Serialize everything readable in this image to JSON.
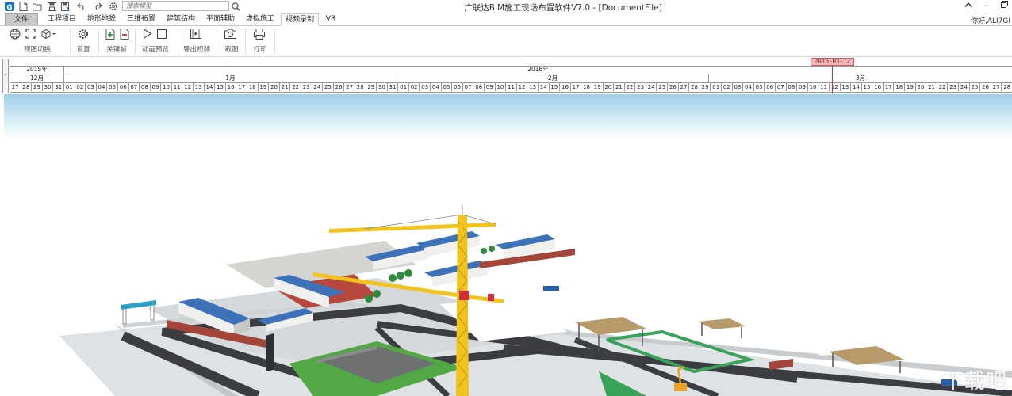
{
  "app": {
    "title": "广联达BIM施工现场布置软件V7.0 - [DocumentFile]",
    "greeting": "你好,ALI7GI",
    "search_placeholder": "搜索模型"
  },
  "tabs": [
    {
      "label": "文件"
    },
    {
      "label": "工程项目"
    },
    {
      "label": "地形地貌"
    },
    {
      "label": "三维布置"
    },
    {
      "label": "建筑结构"
    },
    {
      "label": "平面辅助"
    },
    {
      "label": "虚拟施工"
    },
    {
      "label": "视频录制"
    },
    {
      "label": "VR"
    }
  ],
  "active_tab": "视频录制",
  "ribbon": {
    "view_switch": "视图切换",
    "settings": "设置",
    "keyframe": "关键帧",
    "animation_preview": "动画预览",
    "export_video": "导出视频",
    "screenshot": "截图",
    "print": "打印"
  },
  "timeline": {
    "marker_date": "2016-03-12",
    "years": [
      "2015年",
      "2016年"
    ],
    "months": [
      "12月",
      "1月",
      "2月",
      "3月"
    ],
    "days": [
      "27",
      "28",
      "29",
      "30",
      "31",
      "01",
      "02",
      "03",
      "04",
      "05",
      "06",
      "07",
      "08",
      "09",
      "10",
      "11",
      "12",
      "13",
      "14",
      "15",
      "16",
      "17",
      "18",
      "19",
      "20",
      "21",
      "22",
      "23",
      "24",
      "25",
      "26",
      "27",
      "28",
      "29",
      "30",
      "31",
      "01",
      "02",
      "03",
      "04",
      "05",
      "06",
      "07",
      "08",
      "09",
      "10",
      "11",
      "12",
      "13",
      "14",
      "15",
      "16",
      "17",
      "18",
      "19",
      "20",
      "21",
      "22",
      "23",
      "24",
      "25",
      "26",
      "27",
      "28",
      "29",
      "01",
      "02",
      "03",
      "04",
      "05",
      "06",
      "07",
      "08",
      "09",
      "10",
      "11",
      "12",
      "13",
      "14",
      "15",
      "16",
      "17",
      "18",
      "19",
      "20",
      "21",
      "22",
      "23",
      "24",
      "25",
      "26",
      "27",
      "28"
    ],
    "left_arrow": "‹"
  },
  "watermark": "下载吧",
  "colors": {
    "accent": "#1f6fb5",
    "marker": "#d03040",
    "crane": "#f2c31c",
    "sky": "#cfe8f5",
    "ground": "#dfe2e4",
    "road": "#3b3d42",
    "roof_blue": "#3d72b8",
    "green": "#4aa058"
  }
}
